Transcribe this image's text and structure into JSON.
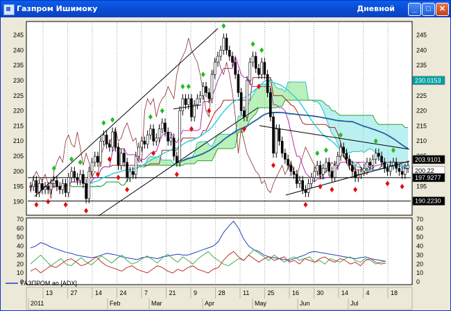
{
  "window": {
    "title": "Газпром Ишимоку",
    "mode": "Дневной",
    "minimize": "_",
    "maximize": "□",
    "close": "✕"
  },
  "price_panel": {
    "y_ticks": [
      "245",
      "240",
      "235",
      "230",
      "225",
      "220",
      "215",
      "210",
      "205",
      "200",
      "195",
      "190"
    ],
    "price_tags": [
      {
        "value": "230.0153",
        "color": "#00a0a0",
        "fg": "#ffffff"
      },
      {
        "value": "203.9101",
        "color": "#000000",
        "fg": "#ffffff"
      },
      {
        "value": "200.22",
        "color": "#ffffff",
        "fg": "#000000"
      },
      {
        "value": "197.9277",
        "color": "#000000",
        "fg": "#ffffff"
      },
      {
        "value": "190.2230",
        "color": "#000000",
        "fg": "#ffffff"
      }
    ]
  },
  "indicator_panel": {
    "legend": "ГАЗПРОМ ао [ADX]",
    "y_ticks": [
      "70",
      "60",
      "50",
      "40",
      "30",
      "20",
      "10",
      "0"
    ]
  },
  "time_axis": {
    "day_labels": [
      "13",
      "27",
      "14",
      "24",
      "7",
      "21",
      "9",
      "28",
      "11",
      "25",
      "16",
      "30",
      "14",
      "4",
      "18"
    ],
    "month_labels": [
      "2011",
      "Feb",
      "Mar",
      "Apr",
      "May",
      "Jun",
      "Jul"
    ]
  },
  "chart_data": [
    {
      "type": "candlestick",
      "ylim": [
        186,
        249
      ],
      "close": [
        195,
        197,
        193,
        196,
        194,
        195,
        194,
        196,
        197,
        195,
        194,
        196,
        193,
        198,
        200,
        198,
        197,
        199,
        196,
        191,
        200,
        203,
        205,
        203,
        210,
        212,
        209,
        208,
        213,
        208,
        202,
        206,
        203,
        198,
        200,
        199,
        205,
        208,
        210,
        209,
        212,
        214,
        210,
        211,
        214,
        216,
        213,
        210,
        211,
        205,
        203,
        220,
        224,
        222,
        224,
        218,
        222,
        224,
        225,
        228,
        226,
        224,
        232,
        236,
        238,
        240,
        244,
        240,
        238,
        236,
        232,
        226,
        220,
        218,
        230,
        236,
        238,
        234,
        232,
        236,
        232,
        226,
        218,
        206,
        214,
        210,
        206,
        204,
        202,
        200,
        199,
        196,
        197,
        194,
        193,
        196,
        198,
        200,
        202,
        199,
        201,
        203,
        200,
        198,
        202,
        205,
        208,
        206,
        204,
        202,
        200,
        198,
        199,
        200,
        201,
        203,
        202,
        204,
        206,
        205,
        203,
        201,
        200,
        202,
        203,
        201,
        200,
        199,
        201,
        202
      ],
      "ichimoku": [
        "tenkan",
        "kijun",
        "senkou_a",
        "senkou_b",
        "chikou"
      ],
      "trend_lines": [
        "channel_upper",
        "channel_lower",
        "triangle_upper",
        "triangle_lower"
      ],
      "horizontal_levels": [
        197.9277,
        190.223
      ]
    },
    {
      "type": "line",
      "title": "ГАЗПРОМ ао [ADX]",
      "ylim": [
        0,
        70
      ],
      "series": [
        {
          "name": "ADX",
          "color": "#2040c0",
          "values": [
            38,
            40,
            44,
            42,
            39,
            37,
            35,
            33,
            32,
            30,
            29,
            28,
            27,
            28,
            30,
            32,
            31,
            30,
            28,
            27,
            26,
            25,
            27,
            28,
            27,
            26,
            28,
            29,
            30,
            31,
            30,
            30,
            32,
            34,
            36,
            38,
            40,
            45,
            55,
            62,
            68,
            60,
            48,
            40,
            36,
            34,
            30,
            28,
            27,
            26,
            25,
            24,
            26,
            28,
            30,
            33,
            34,
            33,
            32,
            31,
            30,
            29,
            28,
            27,
            26,
            27,
            28,
            26,
            25,
            24,
            23
          ]
        },
        {
          "name": "+DI",
          "color": "#40b040",
          "values": [
            20,
            25,
            30,
            24,
            18,
            22,
            26,
            20,
            18,
            23,
            27,
            22,
            19,
            24,
            29,
            25,
            21,
            26,
            30,
            24,
            20,
            22,
            26,
            29,
            25,
            21,
            27,
            31,
            26,
            22,
            28,
            24,
            20,
            26,
            30,
            34,
            28,
            24,
            20,
            18,
            22,
            26,
            24,
            30,
            36,
            32,
            28,
            24,
            30,
            26,
            22,
            26,
            28,
            24,
            26,
            28,
            22,
            24,
            20,
            26,
            24,
            22,
            26,
            28,
            24,
            22,
            26,
            24,
            20,
            22,
            23
          ]
        },
        {
          "name": "-DI",
          "color": "#c03030",
          "values": [
            12,
            15,
            10,
            14,
            18,
            16,
            20,
            24,
            26,
            22,
            18,
            20,
            24,
            28,
            22,
            18,
            16,
            14,
            12,
            16,
            18,
            14,
            12,
            10,
            14,
            18,
            16,
            12,
            10,
            14,
            12,
            16,
            18,
            14,
            12,
            10,
            14,
            16,
            24,
            30,
            34,
            28,
            24,
            30,
            26,
            22,
            26,
            28,
            24,
            26,
            28,
            22,
            24,
            20,
            26,
            24,
            22,
            26,
            28,
            24,
            22,
            26,
            24,
            20,
            22,
            18,
            24,
            26,
            22,
            20,
            21
          ]
        }
      ]
    }
  ]
}
